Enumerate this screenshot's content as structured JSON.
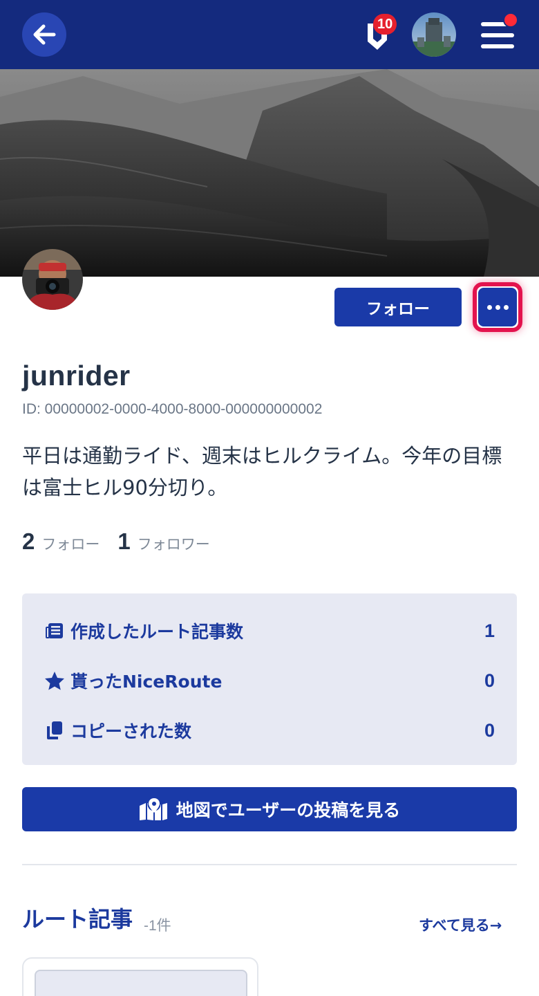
{
  "header": {
    "notification_count": "10",
    "menu_has_unread": true
  },
  "profile": {
    "follow_button": "フォロー",
    "username": "junrider",
    "id_line": "ID: 00000002-0000-4000-8000-000000000002",
    "bio": "平日は通勤ライド、週末はヒルクライム。今年の目標は富士ヒル90分切り。",
    "following_count": "2",
    "following_label": "フォロー",
    "followers_count": "1",
    "followers_label": "フォロワー"
  },
  "stats_panel": {
    "rows": [
      {
        "icon": "article-icon",
        "label": "作成したルート記事数",
        "value": "1"
      },
      {
        "icon": "star-icon",
        "label": "貰ったNiceRoute",
        "value": "0"
      },
      {
        "icon": "copy-icon",
        "label": "コピーされた数",
        "value": "0"
      }
    ]
  },
  "map_button": {
    "icon": "map-pin-icon",
    "label": "地図でユーザーの投稿を見る"
  },
  "route_section": {
    "title": "ルート記事",
    "count": "-1件",
    "see_all": "すべて見る→"
  },
  "colors": {
    "header_bg": "#142a7e",
    "accent": "#1a3aa8",
    "badge": "#e5202e",
    "highlight": "#e3134e",
    "panel_bg": "#e7e9f3"
  }
}
